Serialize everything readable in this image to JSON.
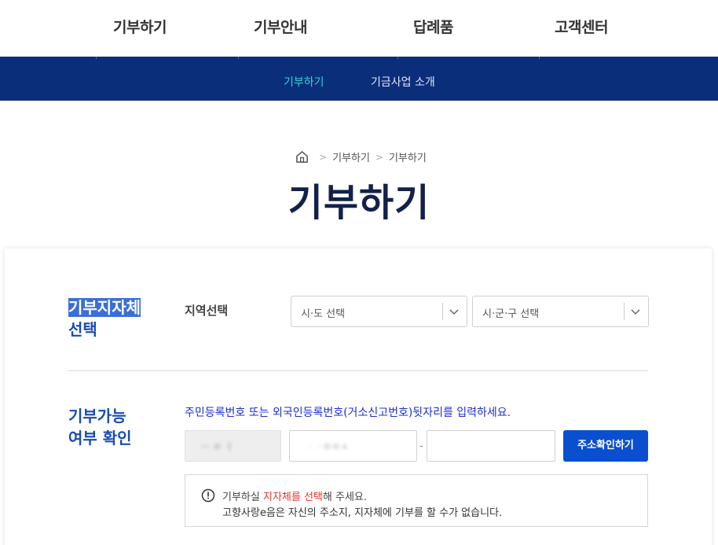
{
  "top_nav": {
    "items": [
      "기부하기",
      "기부안내",
      "답례품",
      "고객센터"
    ]
  },
  "sub_nav": {
    "items": [
      "기부하기",
      "기금사업 소개"
    ],
    "active_index": 0
  },
  "breadcrumb": [
    "기부하기",
    "기부하기"
  ],
  "page_title": "기부하기",
  "region_section": {
    "title_line1": "기부지자체",
    "title_line2": "선택",
    "label": "지역선택",
    "select_sido": "시·도 선택",
    "select_sigungu": "시·군·구 선택"
  },
  "eligibility_section": {
    "title_line1": "기부가능",
    "title_line2": "여부 확인",
    "guide": "주민등록번호 또는 외국인등록번호(거소신고번호)뒷자리를 입력하세요.",
    "input1_value": "ㅡ ㄹ ㅓ",
    "input2_value": "ㆍㆍㅇㅇㅅ",
    "dash": "-",
    "button": "주소확인하기"
  },
  "notice": {
    "line1_pre": "기부하실 ",
    "line1_highlight": "지자체를 선택",
    "line1_post": "해 주세요.",
    "line2": "고향사랑e음은 자신의 주소지, 지자체에 기부를 할 수가 없습니다."
  },
  "colors": {
    "navy": "#0b2e7a",
    "accent_teal": "#2fd6d6",
    "section_blue": "#1a4bb5",
    "button_blue": "#0b4fd1",
    "highlight_red": "#e0362b"
  }
}
